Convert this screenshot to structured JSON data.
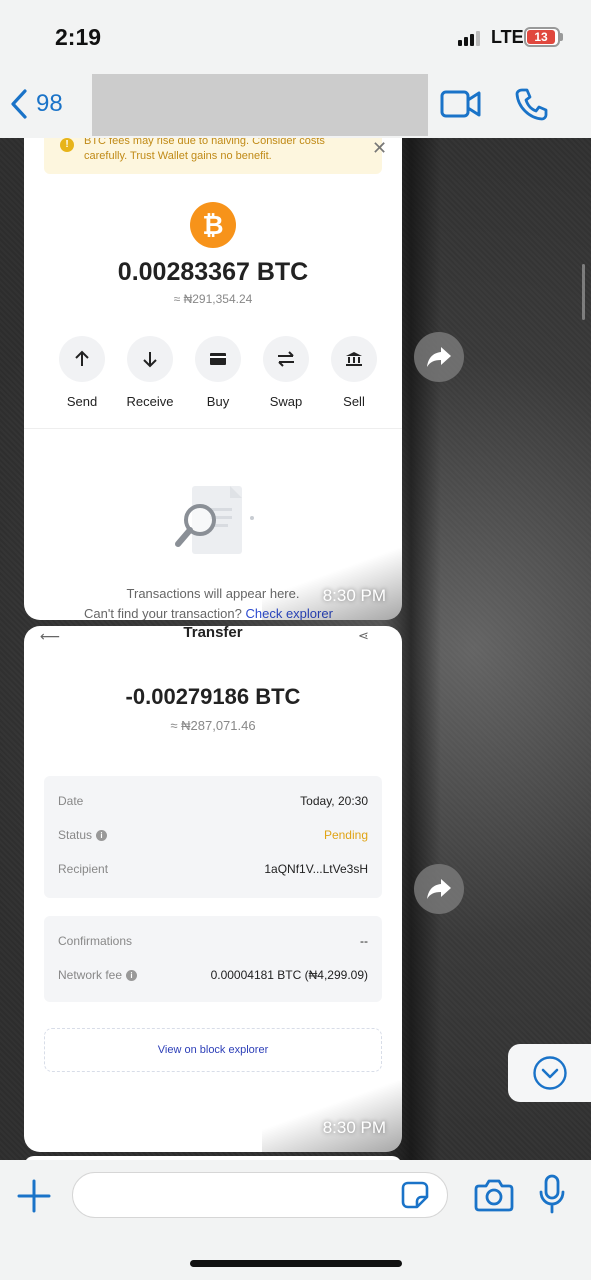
{
  "status_bar": {
    "time": "2:19",
    "network": "LTE",
    "battery": "13"
  },
  "nav": {
    "back_count": "98",
    "accent_color": "#1a73c8"
  },
  "messages": [
    {
      "time": "8:30 PM",
      "wallet": {
        "warning": "BTC fees may rise due to halving. Consider costs carefully. Trust Wallet gains no benefit.",
        "coin_icon": "bitcoin-icon",
        "balance": "0.00283367 BTC",
        "balance_fiat": "≈ ₦291,354.24",
        "actions": [
          {
            "label": "Send",
            "icon": "arrow-up-icon"
          },
          {
            "label": "Receive",
            "icon": "arrow-down-icon"
          },
          {
            "label": "Buy",
            "icon": "card-icon"
          },
          {
            "label": "Swap",
            "icon": "swap-icon"
          },
          {
            "label": "Sell",
            "icon": "bank-icon"
          }
        ],
        "empty_text": "Transactions will appear here.",
        "empty_link_prefix": "Can't find your transaction?",
        "empty_link": "Check explorer"
      }
    },
    {
      "time": "8:30 PM",
      "transfer": {
        "title": "Transfer",
        "amount": "-0.00279186 BTC",
        "amount_fiat": "≈ ₦287,071.46",
        "date_label": "Date",
        "date_value": "Today, 20:30",
        "status_label": "Status",
        "status_value": "Pending",
        "recipient_label": "Recipient",
        "recipient_value": "1aQNf1V...LtVe3sH",
        "confirmations_label": "Confirmations",
        "confirmations_value": "--",
        "fee_label": "Network fee",
        "fee_value": "0.00004181 BTC (₦4,299.09)",
        "explorer_link": "View on block explorer"
      }
    }
  ],
  "input": {
    "placeholder": ""
  }
}
